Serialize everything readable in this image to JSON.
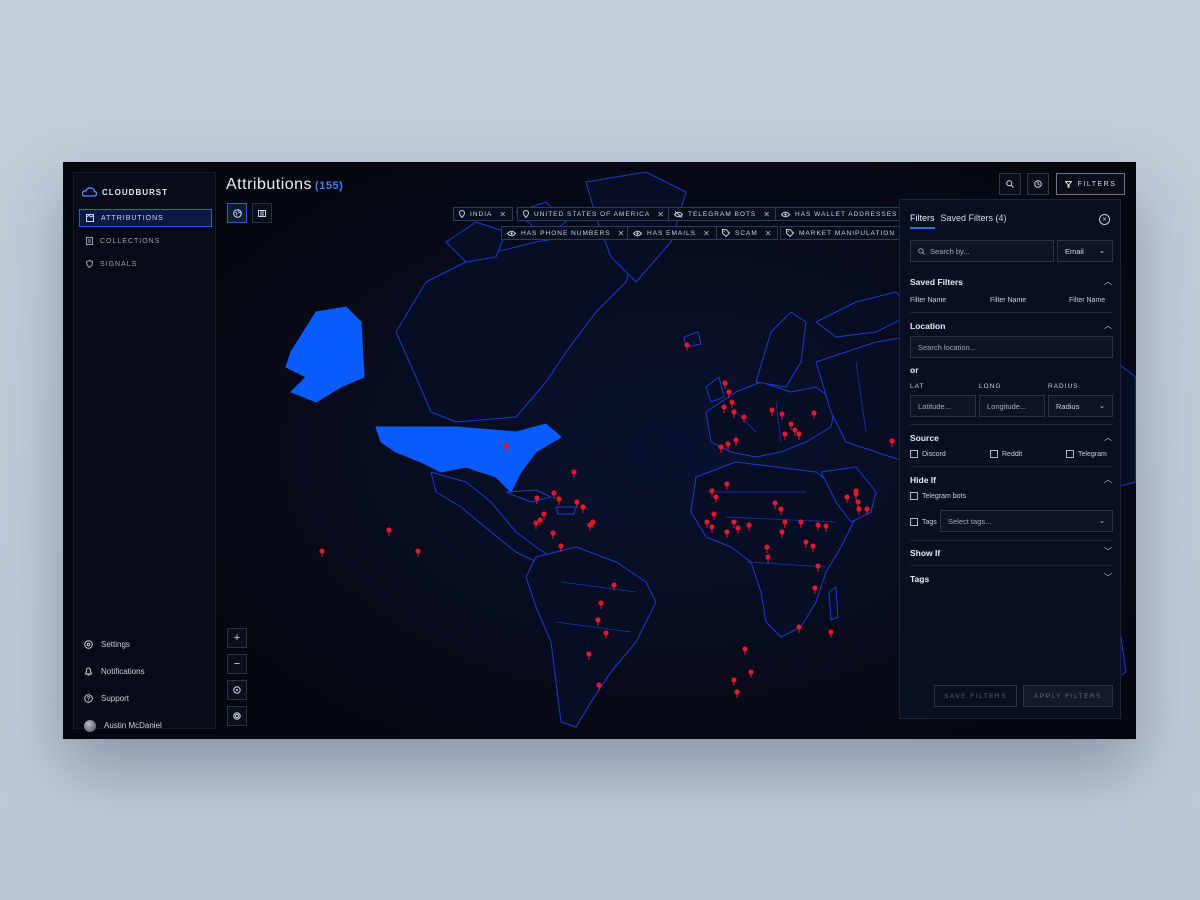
{
  "app": {
    "logo_text": "CLOUDBURST"
  },
  "sidebar": {
    "items": [
      {
        "label": "ATTRIBUTIONS",
        "icon": "map-icon",
        "active": true
      },
      {
        "label": "COLLECTIONS",
        "icon": "document-icon",
        "active": false
      },
      {
        "label": "SIGNALS",
        "icon": "shield-icon",
        "active": false
      }
    ],
    "bottom": [
      {
        "label": "Settings",
        "icon": "gear-icon"
      },
      {
        "label": "Notifications",
        "icon": "bell-icon"
      },
      {
        "label": "Support",
        "icon": "help-icon"
      },
      {
        "label": "Austin McDaniel",
        "icon": "avatar"
      }
    ]
  },
  "header": {
    "title": "Attributions",
    "count": "(155)"
  },
  "toolbar": {
    "filters_label": "FILTERS"
  },
  "chips": [
    {
      "label": "INDIA",
      "icon": "location-pin-icon"
    },
    {
      "label": "UNITED STATES OF AMERICA",
      "icon": "location-pin-icon"
    },
    {
      "label": "TELEGRAM BOTS",
      "icon": "eye-off-icon"
    },
    {
      "label": "HAS WALLET ADDRESSES",
      "icon": "eye-icon"
    },
    {
      "label": "HAS PHONE NUMBERS",
      "icon": "eye-icon"
    },
    {
      "label": "HAS EMAILS",
      "icon": "eye-icon"
    },
    {
      "label": "SCAM",
      "icon": "tag-icon"
    },
    {
      "label": "MARKET MANIPULATION",
      "icon": "tag-icon"
    }
  ],
  "colors": {
    "accent": "#2a6bf0",
    "highlight_country": "#0a5cff",
    "pin": "#e0192d",
    "border_line": "#1c3cc9"
  },
  "filters_panel": {
    "tab_filters": "Filters",
    "tab_saved": "Saved Filters (4)",
    "search_placeholder": "Search by...",
    "search_type": "Email",
    "saved_filters": {
      "title": "Saved Filters",
      "names": [
        "Filter Name",
        "Filter Name",
        "Filter Name"
      ]
    },
    "location": {
      "title": "Location",
      "search_placeholder": "Search location...",
      "or_label": "or",
      "lat_label": "LAT",
      "long_label": "LONG",
      "radius_label": "RADIUS",
      "lat_placeholder": "Latitude...",
      "long_placeholder": "Longitude...",
      "radius_value": "Radius"
    },
    "source": {
      "title": "Source",
      "options": [
        "Discord",
        "Reddit",
        "Telegram"
      ]
    },
    "hide_if": {
      "title": "Hide If",
      "option": "Telegram bots",
      "tags_label": "Tags",
      "tags_placeholder": "Select tags..."
    },
    "show_if": {
      "title": "Show If"
    },
    "tags": {
      "title": "Tags"
    },
    "save_button": "SAVE FILTERS",
    "apply_button": "APPLY FILTERS"
  }
}
